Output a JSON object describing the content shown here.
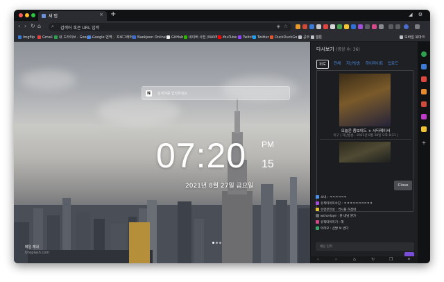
{
  "tab": {
    "title": "새 탭"
  },
  "omnibox": {
    "placeholder": "검색어 혹은 URL 입력"
  },
  "bookmarks": {
    "items": [
      "Imgflip",
      "Gmail",
      "내 드라이브 - Googl...",
      "Google 번역",
      "프로그래머스",
      "Baekjoon Online J...",
      "GitHub",
      "네이버 사전 (NAVER...",
      "YouTube",
      "Twitch",
      "Twitter",
      "DuckDuckGo",
      "공부",
      "웹툰"
    ],
    "other_label": "모바일 북마크"
  },
  "newtab": {
    "search_placeholder": "검색어를 입력하세요",
    "clock": {
      "time": "07:20",
      "ampm": "PM",
      "seconds": "15"
    },
    "date": "2021년 8월 27일 금요일",
    "credit": {
      "line1": "메일 제네",
      "line2": "Unsplash.com"
    }
  },
  "panel": {
    "title": "다시보기",
    "count": "(영상 수: 36)",
    "tabs": [
      "위로",
      "전체",
      "지난방송",
      "하이라이트",
      "업로드"
    ],
    "video": {
      "title": "오늘은 좀보이드 + 시티레이서",
      "meta": "아구 | 지난방송 · 2021년 8월 28일 오후 8:21 |"
    },
    "close_label": "Close",
    "chat": [
      "소녀 : ㅋㅋㅋㅋㅋㅋ",
      "유적타이미수진 : ㅋㅋㅋㅋㅋㅋㅋㅋㅋㅋ",
      "유령분전설 : 역시를 하셨네",
      "wchorlaye : 뭔 내님 뭔가",
      "유적타이미기 : 해",
      "아리모 : 신발 보 번다"
    ],
    "chat_placeholder": "채팅 입력"
  },
  "colors": {
    "accent": "#4e8fe8",
    "purple": "#7a4dd8",
    "panel_bg": "#1f2023"
  }
}
